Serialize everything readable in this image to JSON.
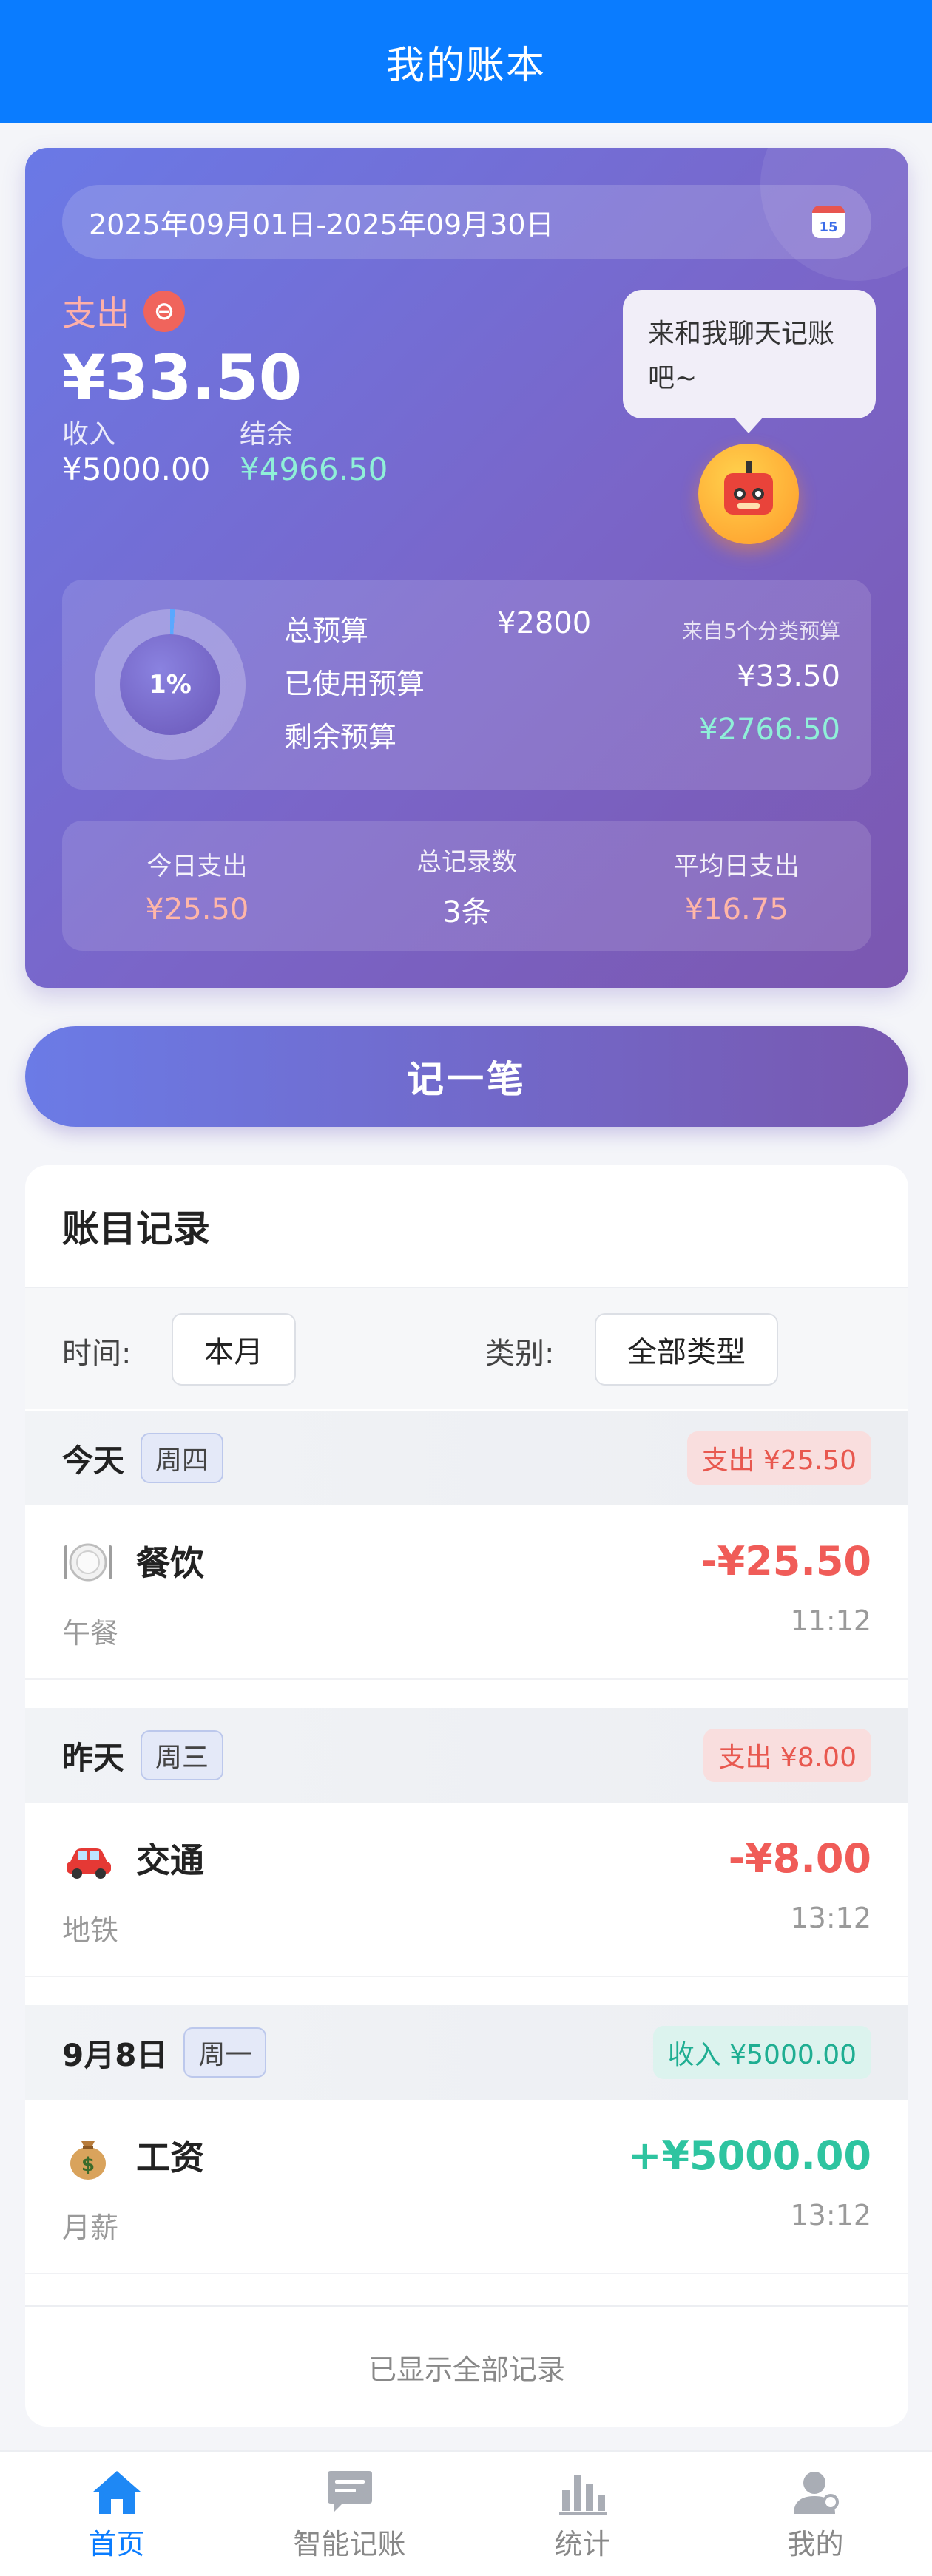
{
  "header": {
    "title": "我的账本"
  },
  "summary": {
    "date_range": "2025年09月01日-2025年09月30日",
    "calendar_icon_day": "15",
    "expense_label": "支出",
    "expense_amount": "¥33.50",
    "income_label": "收入",
    "income_value": "¥5000.00",
    "balance_label": "结余",
    "balance_value": "¥4966.50",
    "chat_prompt": "来和我聊天记账吧~",
    "budget": {
      "used_percent": "1%",
      "used_fraction": 0.01,
      "total_label": "总预算",
      "total_value": "¥2800",
      "source_note": "来自5个分类预算",
      "used_label": "已使用预算",
      "used_value": "¥33.50",
      "remaining_label": "剩余预算",
      "remaining_value": "¥2766.50"
    },
    "stats": [
      {
        "label": "今日支出",
        "value": "¥25.50"
      },
      {
        "label": "总记录数",
        "value": "3条"
      },
      {
        "label": "平均日支出",
        "value": "¥16.75"
      }
    ]
  },
  "record_button": "记一笔",
  "records": {
    "title": "账目记录",
    "time_label": "时间:",
    "time_value": "本月",
    "category_label": "类别:",
    "category_value": "全部类型",
    "groups": [
      {
        "day": "今天",
        "weekday": "周四",
        "summary": "支出 ¥25.50",
        "entries": [
          {
            "icon": "plate-icon",
            "category": "餐饮",
            "note": "午餐",
            "amount": "-¥25.50",
            "time": "11:12"
          }
        ]
      },
      {
        "day": "昨天",
        "weekday": "周三",
        "summary": "支出 ¥8.00",
        "entries": [
          {
            "icon": "car-icon",
            "category": "交通",
            "note": "地铁",
            "amount": "-¥8.00",
            "time": "13:12"
          }
        ]
      },
      {
        "day": "9月8日",
        "weekday": "周一",
        "summary": "收入 ¥5000.00",
        "entries": [
          {
            "icon": "money-bag-icon",
            "category": "工资",
            "note": "月薪",
            "amount": "+¥5000.00",
            "time": "13:12"
          }
        ]
      }
    ],
    "end_note": "已显示全部记录"
  },
  "nav": [
    {
      "label": "首页",
      "icon": "home-icon",
      "active": true
    },
    {
      "label": "智能记账",
      "icon": "chat-icon",
      "active": false
    },
    {
      "label": "统计",
      "icon": "chart-icon",
      "active": false
    },
    {
      "label": "我的",
      "icon": "user-icon",
      "active": false
    }
  ],
  "colors": {
    "primary": "#0a7cff",
    "expense": "#f05c58",
    "income": "#2ec4a0",
    "balance_text": "#8ff0d8",
    "stat_text": "#ffb6a8"
  }
}
